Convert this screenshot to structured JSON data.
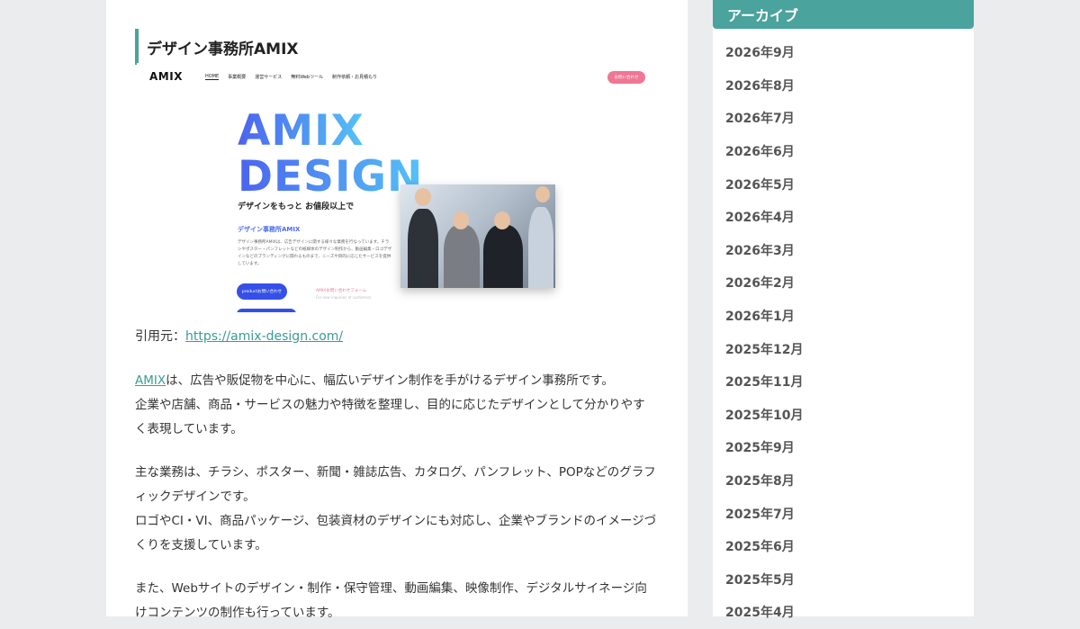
{
  "article": {
    "heading": "デザイン事務所AMIX",
    "screenshot": {
      "logo": "AMIX",
      "menu": [
        "HOME",
        "事業概要",
        "運営サービス",
        "無料Webツール",
        "制作依頼・お見積もり"
      ],
      "cta": "お問い合わせ",
      "hero_line1": "AMIX",
      "hero_line2": "DESIGN",
      "tagline": "デザインをもっと お値段以上で",
      "sub_title": "デザイン事務所AMIX",
      "body": "デザイン事務所AMIXは、広告デザインに関する様々な業務を行なっています。チラシやポスター・パンフレットなどの紙媒体のデザイン制作から、動画編集・ロゴデザインなどのブランディングに関わるものまで、ニーズや目的に応じたサービスを提供しています。",
      "btn_contact": "productお問い合わせ",
      "form_link": "AMIXお問い合わせフォーム",
      "form_sub": "For new inquiries of customers"
    },
    "citation_label": "引用元：",
    "citation_url": "https://amix-design.com/",
    "p1_link": "AMIX",
    "p1_line1_rest": "は、広告や販促物を中心に、幅広いデザイン制作を手がけるデザイン事務所です。",
    "p1_line2": "企業や店舗、商品・サービスの魅力や特徴を整理し、目的に応じたデザインとして分かりやすく表現しています。",
    "p2_line1": "主な業務は、チラシ、ポスター、新聞・雑誌広告、カタログ、パンフレット、POPなどのグラフィックデザインです。",
    "p2_line2": "ロゴやCI・VI、商品パッケージ、包装資材のデザインにも対応し、企業やブランドのイメージづくりを支援しています。",
    "p3_line1": "また、Webサイトのデザイン・制作・保守管理、動画編集、映像制作、デジタルサイネージ向けコンテンツの制作も行っています。"
  },
  "sidebar": {
    "title": "アーカイブ",
    "archives": [
      "2026年9月",
      "2026年8月",
      "2026年7月",
      "2026年6月",
      "2026年5月",
      "2026年4月",
      "2026年3月",
      "2026年2月",
      "2026年1月",
      "2025年12月",
      "2025年11月",
      "2025年10月",
      "2025年9月",
      "2025年8月",
      "2025年7月",
      "2025年6月",
      "2025年5月",
      "2025年4月"
    ]
  },
  "colors": {
    "accent": "#4aa39c",
    "link": "#3a9d94",
    "background": "#eaecee"
  }
}
